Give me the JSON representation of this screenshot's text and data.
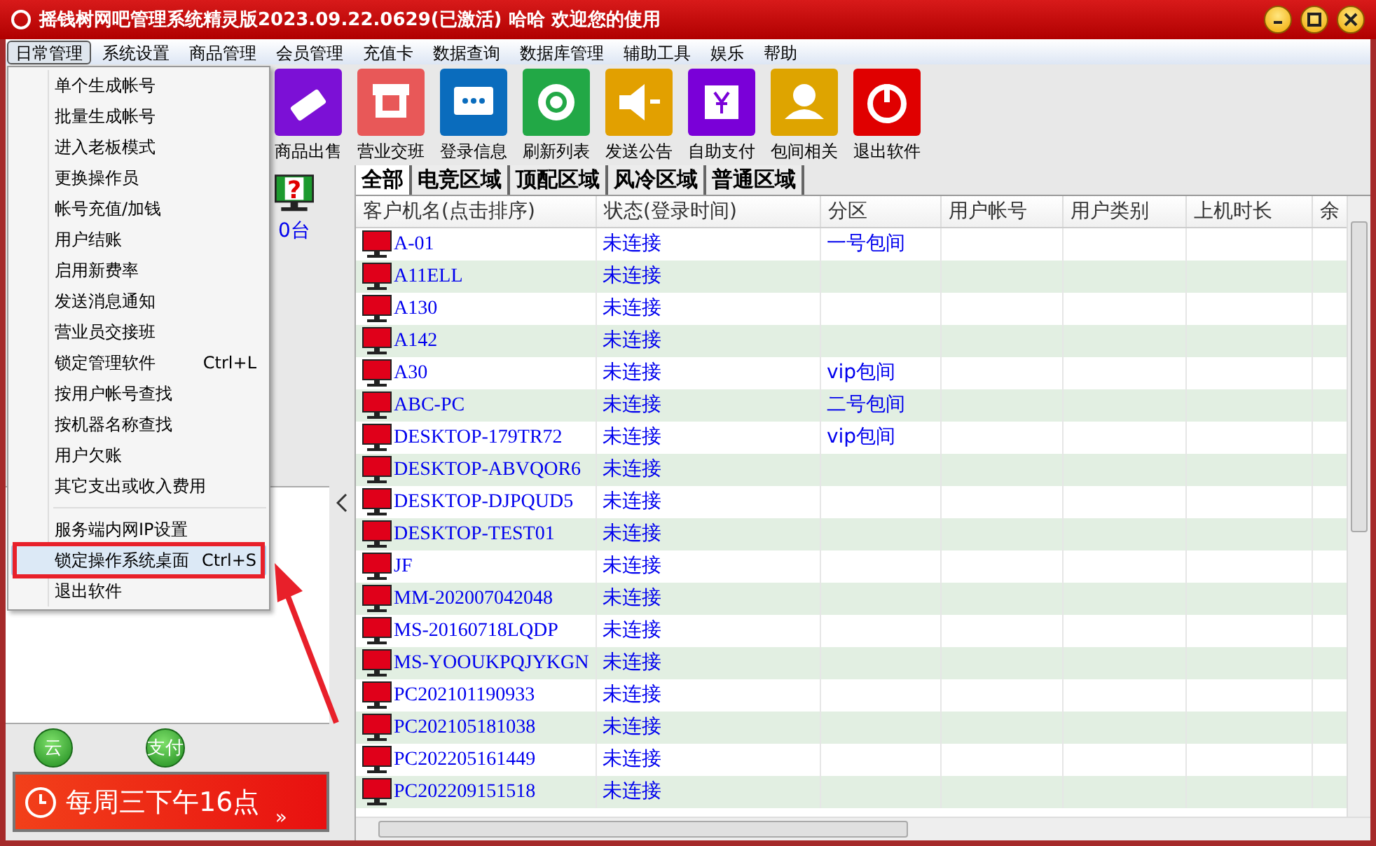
{
  "window": {
    "title": "摇钱树网吧管理系统精灵版2023.09.22.0629(已激活)  哈哈 欢迎您的使用"
  },
  "menu_bar": [
    {
      "label": "日常管理",
      "selected": true
    },
    {
      "label": "系统设置",
      "selected": false
    },
    {
      "label": "商品管理",
      "selected": false
    },
    {
      "label": "会员管理",
      "selected": false
    },
    {
      "label": "充值卡",
      "selected": false
    },
    {
      "label": "数据查询",
      "selected": false
    },
    {
      "label": "数据库管理",
      "selected": false
    },
    {
      "label": "辅助工具",
      "selected": false
    },
    {
      "label": "娱乐",
      "selected": false
    },
    {
      "label": "帮助",
      "selected": false
    }
  ],
  "dropdown_menu": [
    {
      "kind": "item",
      "label": "单个生成帐号",
      "selected": false
    },
    {
      "kind": "item",
      "label": "批量生成帐号",
      "selected": false
    },
    {
      "kind": "item",
      "label": "进入老板模式",
      "selected": false
    },
    {
      "kind": "item",
      "label": "更换操作员",
      "selected": false
    },
    {
      "kind": "item",
      "label": "帐号充值/加钱",
      "selected": false
    },
    {
      "kind": "item",
      "label": "用户结账",
      "selected": false
    },
    {
      "kind": "item",
      "label": "启用新费率",
      "selected": false
    },
    {
      "kind": "item",
      "label": "发送消息通知",
      "selected": false
    },
    {
      "kind": "item",
      "label": "营业员交接班",
      "selected": false
    },
    {
      "kind": "item",
      "label": "锁定管理软件",
      "shortcut": "Ctrl+L",
      "selected": false
    },
    {
      "kind": "item",
      "label": "按用户帐号查找",
      "selected": false
    },
    {
      "kind": "item",
      "label": "按机器名称查找",
      "selected": false
    },
    {
      "kind": "item",
      "label": "用户欠账",
      "selected": false
    },
    {
      "kind": "item",
      "label": "其它支出或收入费用",
      "selected": false
    },
    {
      "kind": "separator"
    },
    {
      "kind": "item",
      "label": "服务端内网IP设置",
      "selected": false
    },
    {
      "kind": "item",
      "label": "锁定操作系统桌面",
      "shortcut": "Ctrl+S",
      "selected": true
    },
    {
      "kind": "item",
      "label": "退出软件",
      "selected": false
    }
  ],
  "toolbar": [
    {
      "label": "商品出售",
      "color": "#7c10d6"
    },
    {
      "label": "营业交班",
      "color": "#e85858"
    },
    {
      "label": "登录信息",
      "color": "#0a6cbd"
    },
    {
      "label": "刷新列表",
      "color": "#22a846"
    },
    {
      "label": "发送公告",
      "color": "#e2a000"
    },
    {
      "label": "自助支付",
      "color": "#7a00d8"
    },
    {
      "label": "包间相关",
      "color": "#dea400"
    },
    {
      "label": "退出软件",
      "color": "#e00000"
    }
  ],
  "left_panel": {
    "status_mark": "?",
    "online_count": "0台",
    "quick_buttons": [
      "云",
      "支付"
    ],
    "banner": {
      "text": "每周三下午16点",
      "more": "»"
    }
  },
  "tabs": [
    {
      "label": "全部",
      "selected": true
    },
    {
      "label": "电竞区域",
      "selected": false
    },
    {
      "label": "顶配区域",
      "selected": false
    },
    {
      "label": "风冷区域",
      "selected": false
    },
    {
      "label": "普通区域",
      "selected": false
    }
  ],
  "table": {
    "columns": [
      "客户机名(点击排序)",
      "状态(登录时间)",
      "分区",
      "用户帐号",
      "用户类别",
      "上机时长",
      "余"
    ],
    "rows": [
      {
        "name": "A-01",
        "status": "未连接",
        "zone": "一号包间"
      },
      {
        "name": "A11ELL",
        "status": "未连接"
      },
      {
        "name": "A130",
        "status": "未连接"
      },
      {
        "name": "A142",
        "status": "未连接"
      },
      {
        "name": "A30",
        "status": "未连接",
        "zone": "vip包间"
      },
      {
        "name": "ABC-PC",
        "status": "未连接",
        "zone": "二号包间"
      },
      {
        "name": "DESKTOP-179TR72",
        "status": "未连接",
        "zone": "vip包间"
      },
      {
        "name": "DESKTOP-ABVQOR6",
        "status": "未连接"
      },
      {
        "name": "DESKTOP-DJPQUD5",
        "status": "未连接"
      },
      {
        "name": "DESKTOP-TEST01",
        "status": "未连接"
      },
      {
        "name": "JF",
        "status": "未连接"
      },
      {
        "name": "MM-202007042048",
        "status": "未连接"
      },
      {
        "name": "MS-20160718LQDP",
        "status": "未连接"
      },
      {
        "name": "MS-YOOUKPQJYKGN",
        "status": "未连接"
      },
      {
        "name": "PC202101190933",
        "status": "未连接"
      },
      {
        "name": "PC202105181038",
        "status": "未连接"
      },
      {
        "name": "PC202205161449",
        "status": "未连接"
      },
      {
        "name": "PC202209151518",
        "status": "未连接"
      }
    ]
  }
}
